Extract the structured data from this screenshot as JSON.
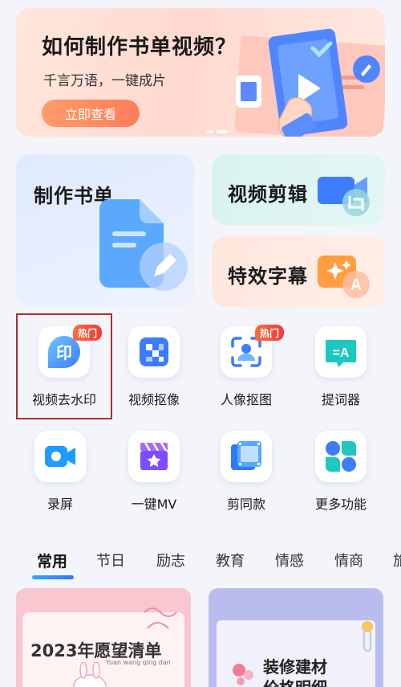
{
  "banner": {
    "title": "如何制作书单视频？",
    "subtitle": "千言万语，一键成片",
    "button": "立即查看"
  },
  "features": {
    "booklist": "制作书单",
    "video_edit": "视频剪辑",
    "subtitles": "特效字幕"
  },
  "tools_row1": [
    {
      "label": "视频去水印",
      "badge": "热门",
      "icon_text": "印"
    },
    {
      "label": "视频抠像"
    },
    {
      "label": "人像抠图",
      "badge": "热门"
    },
    {
      "label": "提词器",
      "icon_text": "=A"
    }
  ],
  "tools_row2": [
    {
      "label": "录屏"
    },
    {
      "label": "一键MV"
    },
    {
      "label": "剪同款"
    },
    {
      "label": "更多功能"
    }
  ],
  "tabs": [
    "常用",
    "节日",
    "励志",
    "教育",
    "情感",
    "情商",
    "旅"
  ],
  "templates": [
    {
      "title": "2023年愿望清单",
      "pinyin": "Yuan  wang  qing  dan"
    },
    {
      "title": "装修建材",
      "title2": "价格明细"
    }
  ],
  "colors": {
    "accent": "#2b7bff",
    "hot": "#f23a3a",
    "selection": "#b0302a"
  }
}
